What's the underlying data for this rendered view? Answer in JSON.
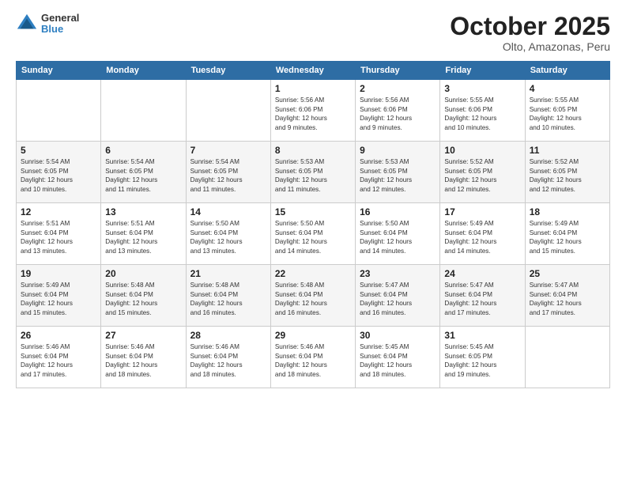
{
  "logo": {
    "line1": "General",
    "line2": "Blue"
  },
  "title": "October 2025",
  "subtitle": "Olto, Amazonas, Peru",
  "days_of_week": [
    "Sunday",
    "Monday",
    "Tuesday",
    "Wednesday",
    "Thursday",
    "Friday",
    "Saturday"
  ],
  "weeks": [
    [
      {
        "day": "",
        "info": ""
      },
      {
        "day": "",
        "info": ""
      },
      {
        "day": "",
        "info": ""
      },
      {
        "day": "1",
        "info": "Sunrise: 5:56 AM\nSunset: 6:06 PM\nDaylight: 12 hours\nand 9 minutes."
      },
      {
        "day": "2",
        "info": "Sunrise: 5:56 AM\nSunset: 6:06 PM\nDaylight: 12 hours\nand 9 minutes."
      },
      {
        "day": "3",
        "info": "Sunrise: 5:55 AM\nSunset: 6:06 PM\nDaylight: 12 hours\nand 10 minutes."
      },
      {
        "day": "4",
        "info": "Sunrise: 5:55 AM\nSunset: 6:05 PM\nDaylight: 12 hours\nand 10 minutes."
      }
    ],
    [
      {
        "day": "5",
        "info": "Sunrise: 5:54 AM\nSunset: 6:05 PM\nDaylight: 12 hours\nand 10 minutes."
      },
      {
        "day": "6",
        "info": "Sunrise: 5:54 AM\nSunset: 6:05 PM\nDaylight: 12 hours\nand 11 minutes."
      },
      {
        "day": "7",
        "info": "Sunrise: 5:54 AM\nSunset: 6:05 PM\nDaylight: 12 hours\nand 11 minutes."
      },
      {
        "day": "8",
        "info": "Sunrise: 5:53 AM\nSunset: 6:05 PM\nDaylight: 12 hours\nand 11 minutes."
      },
      {
        "day": "9",
        "info": "Sunrise: 5:53 AM\nSunset: 6:05 PM\nDaylight: 12 hours\nand 12 minutes."
      },
      {
        "day": "10",
        "info": "Sunrise: 5:52 AM\nSunset: 6:05 PM\nDaylight: 12 hours\nand 12 minutes."
      },
      {
        "day": "11",
        "info": "Sunrise: 5:52 AM\nSunset: 6:05 PM\nDaylight: 12 hours\nand 12 minutes."
      }
    ],
    [
      {
        "day": "12",
        "info": "Sunrise: 5:51 AM\nSunset: 6:04 PM\nDaylight: 12 hours\nand 13 minutes."
      },
      {
        "day": "13",
        "info": "Sunrise: 5:51 AM\nSunset: 6:04 PM\nDaylight: 12 hours\nand 13 minutes."
      },
      {
        "day": "14",
        "info": "Sunrise: 5:50 AM\nSunset: 6:04 PM\nDaylight: 12 hours\nand 13 minutes."
      },
      {
        "day": "15",
        "info": "Sunrise: 5:50 AM\nSunset: 6:04 PM\nDaylight: 12 hours\nand 14 minutes."
      },
      {
        "day": "16",
        "info": "Sunrise: 5:50 AM\nSunset: 6:04 PM\nDaylight: 12 hours\nand 14 minutes."
      },
      {
        "day": "17",
        "info": "Sunrise: 5:49 AM\nSunset: 6:04 PM\nDaylight: 12 hours\nand 14 minutes."
      },
      {
        "day": "18",
        "info": "Sunrise: 5:49 AM\nSunset: 6:04 PM\nDaylight: 12 hours\nand 15 minutes."
      }
    ],
    [
      {
        "day": "19",
        "info": "Sunrise: 5:49 AM\nSunset: 6:04 PM\nDaylight: 12 hours\nand 15 minutes."
      },
      {
        "day": "20",
        "info": "Sunrise: 5:48 AM\nSunset: 6:04 PM\nDaylight: 12 hours\nand 15 minutes."
      },
      {
        "day": "21",
        "info": "Sunrise: 5:48 AM\nSunset: 6:04 PM\nDaylight: 12 hours\nand 16 minutes."
      },
      {
        "day": "22",
        "info": "Sunrise: 5:48 AM\nSunset: 6:04 PM\nDaylight: 12 hours\nand 16 minutes."
      },
      {
        "day": "23",
        "info": "Sunrise: 5:47 AM\nSunset: 6:04 PM\nDaylight: 12 hours\nand 16 minutes."
      },
      {
        "day": "24",
        "info": "Sunrise: 5:47 AM\nSunset: 6:04 PM\nDaylight: 12 hours\nand 17 minutes."
      },
      {
        "day": "25",
        "info": "Sunrise: 5:47 AM\nSunset: 6:04 PM\nDaylight: 12 hours\nand 17 minutes."
      }
    ],
    [
      {
        "day": "26",
        "info": "Sunrise: 5:46 AM\nSunset: 6:04 PM\nDaylight: 12 hours\nand 17 minutes."
      },
      {
        "day": "27",
        "info": "Sunrise: 5:46 AM\nSunset: 6:04 PM\nDaylight: 12 hours\nand 18 minutes."
      },
      {
        "day": "28",
        "info": "Sunrise: 5:46 AM\nSunset: 6:04 PM\nDaylight: 12 hours\nand 18 minutes."
      },
      {
        "day": "29",
        "info": "Sunrise: 5:46 AM\nSunset: 6:04 PM\nDaylight: 12 hours\nand 18 minutes."
      },
      {
        "day": "30",
        "info": "Sunrise: 5:45 AM\nSunset: 6:04 PM\nDaylight: 12 hours\nand 18 minutes."
      },
      {
        "day": "31",
        "info": "Sunrise: 5:45 AM\nSunset: 6:05 PM\nDaylight: 12 hours\nand 19 minutes."
      },
      {
        "day": "",
        "info": ""
      }
    ]
  ]
}
